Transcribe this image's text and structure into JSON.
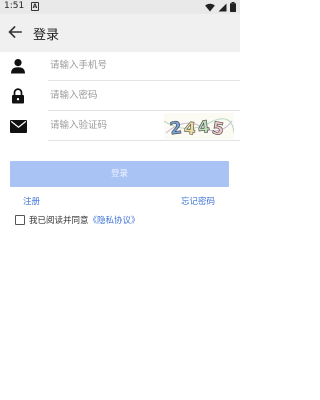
{
  "status_bar": {
    "time": "1:51",
    "notification_glyph": "A"
  },
  "app_bar": {
    "title": "登录",
    "back_icon": "arrow-left-icon"
  },
  "form": {
    "phone": {
      "placeholder": "请输入手机号",
      "value": "",
      "icon": "user-icon"
    },
    "password": {
      "placeholder": "请输入密码",
      "value": "",
      "icon": "lock-icon"
    },
    "captcha": {
      "placeholder": "请输入验证码",
      "value": "",
      "icon": "envelope-icon",
      "image_text": "2445"
    }
  },
  "login_button": {
    "label": "登录"
  },
  "links": {
    "register": "注册",
    "forgot_password": "忘记密码"
  },
  "agreement": {
    "checked": false,
    "text": "我已阅读并同意",
    "link": "《隐私协议》"
  },
  "colors": {
    "accent": "#3f73d8",
    "button_bg": "#a9c3f4",
    "app_bar_bg": "#f0f0f0",
    "status_bar_bg": "#e9e9e9"
  }
}
